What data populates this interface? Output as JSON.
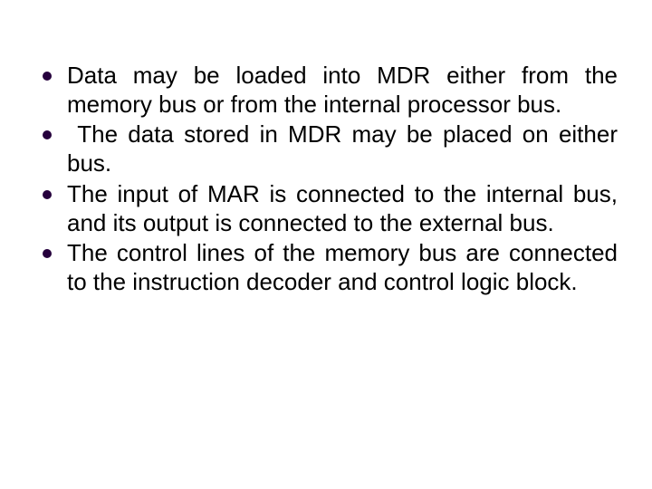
{
  "bullets": [
    {
      "text": "Data may be loaded into MDR either from the memory bus or from the internal  processor bus."
    },
    {
      "text": "The data stored in MDR may be placed on either bus.",
      "indent": true
    },
    {
      "text": "The input of MAR  is connected to the internal bus, and its output is connected to the external bus."
    },
    {
      "text": "The  control lines of the memory bus are connected to the instruction decoder and control logic  block."
    }
  ]
}
